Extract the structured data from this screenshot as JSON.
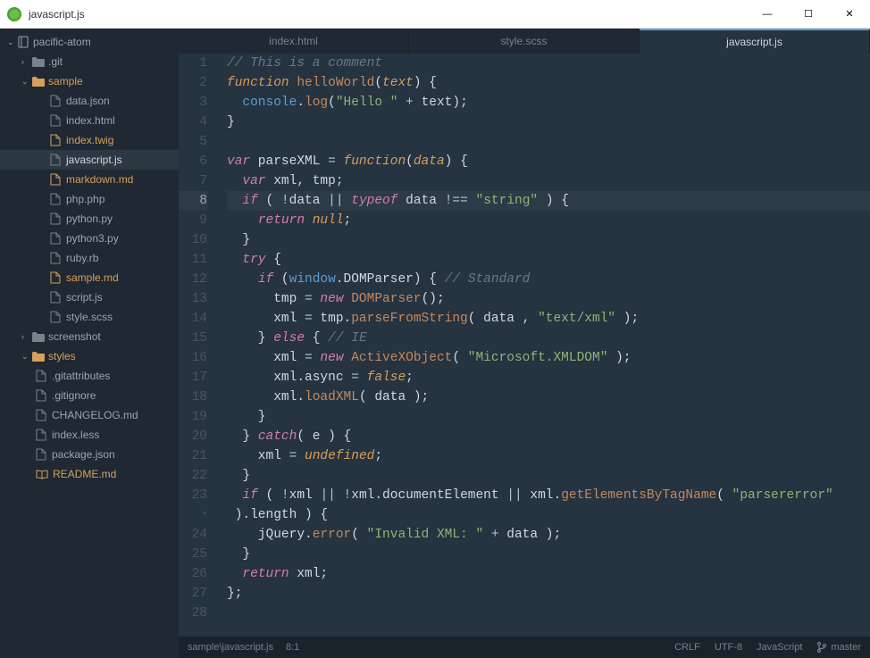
{
  "window": {
    "title": "javascript.js"
  },
  "controls": {
    "min": "—",
    "max": "☐",
    "close": "✕"
  },
  "tree": {
    "root": "pacific-atom",
    "items": [
      {
        "label": ".git",
        "type": "folder-closed",
        "indent": 24,
        "chev": "›"
      },
      {
        "label": "sample",
        "type": "folder-open",
        "indent": 24,
        "chev": "⌄",
        "modified": true
      },
      {
        "label": "data.json",
        "type": "file",
        "indent": 56
      },
      {
        "label": "index.html",
        "type": "file",
        "indent": 56
      },
      {
        "label": "index.twig",
        "type": "file",
        "indent": 56,
        "modified": true
      },
      {
        "label": "javascript.js",
        "type": "file",
        "indent": 56,
        "selected": true
      },
      {
        "label": "markdown.md",
        "type": "file",
        "indent": 56,
        "modified": true
      },
      {
        "label": "php.php",
        "type": "file",
        "indent": 56
      },
      {
        "label": "python.py",
        "type": "file",
        "indent": 56
      },
      {
        "label": "python3.py",
        "type": "file",
        "indent": 56
      },
      {
        "label": "ruby.rb",
        "type": "file",
        "indent": 56
      },
      {
        "label": "sample.md",
        "type": "file",
        "indent": 56,
        "modified": true
      },
      {
        "label": "script.js",
        "type": "file",
        "indent": 56
      },
      {
        "label": "style.scss",
        "type": "file",
        "indent": 56
      },
      {
        "label": "screenshot",
        "type": "folder-closed",
        "indent": 24,
        "chev": "›"
      },
      {
        "label": "styles",
        "type": "folder-open",
        "indent": 24,
        "chev": "⌄",
        "modified": true
      },
      {
        "label": ".gitattributes",
        "type": "file",
        "indent": 40
      },
      {
        "label": ".gitignore",
        "type": "file",
        "indent": 40
      },
      {
        "label": "CHANGELOG.md",
        "type": "file",
        "indent": 40
      },
      {
        "label": "index.less",
        "type": "file",
        "indent": 40
      },
      {
        "label": "package.json",
        "type": "file",
        "indent": 40
      },
      {
        "label": "README.md",
        "type": "book",
        "indent": 40,
        "modified": true
      }
    ]
  },
  "tabs": [
    {
      "label": "index.html"
    },
    {
      "label": "style.scss"
    },
    {
      "label": "javascript.js",
      "active": true
    }
  ],
  "code": {
    "highlight": 8,
    "lines": [
      {
        "n": 1,
        "html": "<span class='c-cmt'>// This is a comment</span>"
      },
      {
        "n": 2,
        "html": "<span class='c-ty'>function</span> <span class='c-fn'>helloWorld</span>(<span class='c-val'>text</span>) {"
      },
      {
        "n": 3,
        "html": "  <span class='c-pr'>console</span>.<span class='c-fn'>log</span>(<span class='c-str'>\"Hello \"</span> <span class='c-op'>+</span> text);"
      },
      {
        "n": 4,
        "html": "}"
      },
      {
        "n": 5,
        "html": ""
      },
      {
        "n": 6,
        "html": "<span class='c-kw'>var</span> parseXML <span class='c-op'>=</span> <span class='c-ty'>function</span>(<span class='c-val'>data</span>) {"
      },
      {
        "n": 7,
        "html": "  <span class='c-kw'>var</span> xml, tmp;"
      },
      {
        "n": 8,
        "html": "  <span class='c-kw'>if</span> ( <span class='c-op'>!</span>data <span class='c-op'>||</span> <span class='c-kw'>typeof</span> data <span class='c-op'>!==</span> <span class='c-str'>\"string\"</span> ) {"
      },
      {
        "n": 9,
        "html": "    <span class='c-kw'>return</span> <span class='c-val'>null</span>;"
      },
      {
        "n": 10,
        "html": "  }"
      },
      {
        "n": 11,
        "html": "  <span class='c-kw'>try</span> {"
      },
      {
        "n": 12,
        "html": "    <span class='c-kw'>if</span> (<span class='c-pr'>window</span>.DOMParser) { <span class='c-cmt'>// Standard</span>"
      },
      {
        "n": 13,
        "html": "      tmp <span class='c-op'>=</span> <span class='c-kw'>new</span> <span class='c-fn'>DOMParser</span>();"
      },
      {
        "n": 14,
        "html": "      xml <span class='c-op'>=</span> tmp.<span class='c-fn'>parseFromString</span>( data , <span class='c-str'>\"text/xml\"</span> );"
      },
      {
        "n": 15,
        "html": "    } <span class='c-kw'>else</span> { <span class='c-cmt'>// IE</span>"
      },
      {
        "n": 16,
        "html": "      xml <span class='c-op'>=</span> <span class='c-kw'>new</span> <span class='c-fn'>ActiveXObject</span>( <span class='c-str'>\"Microsoft.XMLDOM\"</span> );"
      },
      {
        "n": 17,
        "html": "      xml.async <span class='c-op'>=</span> <span class='c-val'>false</span>;"
      },
      {
        "n": 18,
        "html": "      xml.<span class='c-fn'>loadXML</span>( data );"
      },
      {
        "n": 19,
        "html": "    }"
      },
      {
        "n": 20,
        "html": "  } <span class='c-kw'>catch</span>( e ) {"
      },
      {
        "n": 21,
        "html": "    xml <span class='c-op'>=</span> <span class='c-val'>undefined</span>;"
      },
      {
        "n": 22,
        "html": "  }"
      },
      {
        "n": 23,
        "html": "  <span class='c-kw'>if</span> ( <span class='c-op'>!</span>xml <span class='c-op'>||</span> <span class='c-op'>!</span>xml.documentElement <span class='c-op'>||</span> xml.<span class='c-fn'>getElementsByTagName</span>( <span class='c-str'>\"parsererror\"</span>",
        "fold": "•"
      },
      {
        "n": "",
        "html": " ).length ) {"
      },
      {
        "n": 24,
        "html": "    jQuery.<span class='c-fn'>error</span>( <span class='c-str'>\"Invalid XML: \"</span> <span class='c-op'>+</span> data );"
      },
      {
        "n": 25,
        "html": "  }"
      },
      {
        "n": 26,
        "html": "  <span class='c-kw'>return</span> xml;"
      },
      {
        "n": 27,
        "html": "};"
      },
      {
        "n": 28,
        "html": ""
      }
    ]
  },
  "status": {
    "path": "sample\\javascript.js",
    "cursor": "8:1",
    "line_ending": "CRLF",
    "encoding": "UTF-8",
    "language": "JavaScript",
    "branch": "master"
  }
}
